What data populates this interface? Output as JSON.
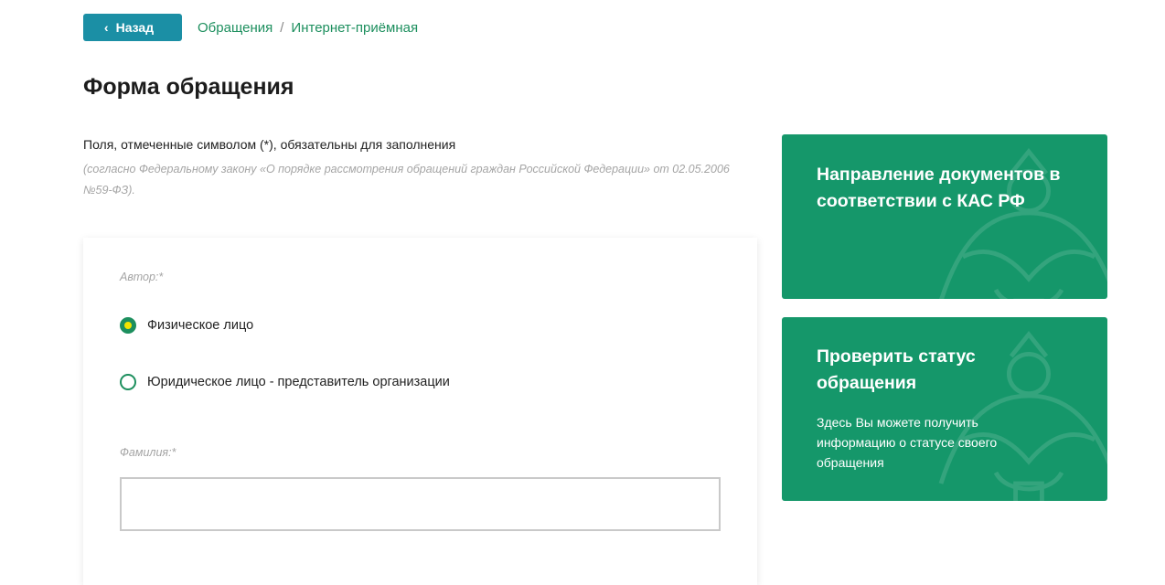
{
  "nav": {
    "back_label": "Назад",
    "breadcrumb": [
      "Обращения",
      "Интернет-приёмная"
    ],
    "separator": "/"
  },
  "page": {
    "title": "Форма обращения",
    "required_note": "Поля, отмеченные символом (*), обязательны для заполнения",
    "law_note": "(согласно Федеральному закону «О порядке рассмотрения обращений граждан Российской Федерации» от 02.05.2006 №59-ФЗ)."
  },
  "form": {
    "author_label": "Автор:*",
    "author_options": [
      {
        "label": "Физическое лицо",
        "checked": true
      },
      {
        "label": "Юридическое лицо - представитель организации",
        "checked": false
      }
    ],
    "surname_label": "Фамилия:*",
    "surname_value": ""
  },
  "side_cards": [
    {
      "title": "Направление документов в соответствии с КАС РФ",
      "icon": "emblem-eagle-icon"
    },
    {
      "title": "Проверить статус обращения",
      "description": "Здесь Вы можете получить информацию о статусе своего обращения",
      "icon": "emblem-eagle-icon"
    }
  ],
  "colors": {
    "accent_blue": "#1b8fa5",
    "brand_green": "#15976a",
    "link_green": "#1d8f5e",
    "radio_dot": "#f2e400"
  }
}
